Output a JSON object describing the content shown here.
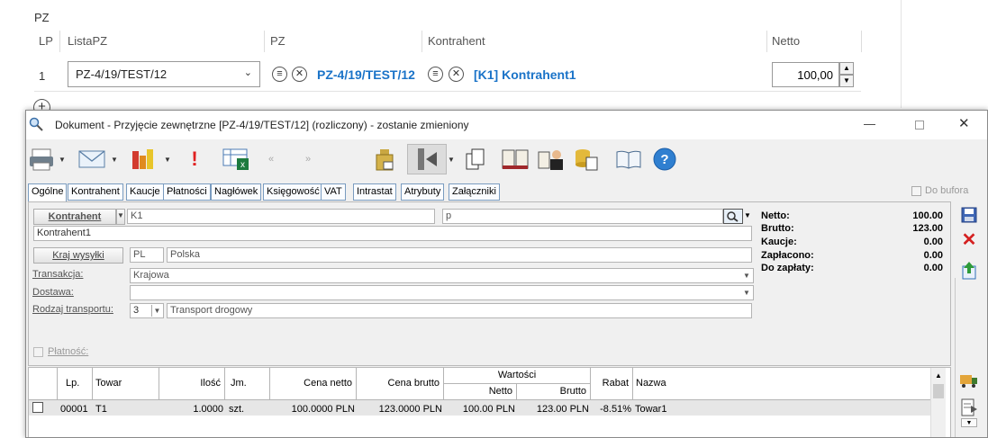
{
  "pz_section": {
    "title": "PZ",
    "headers": {
      "lp": "LP",
      "lista": "ListaPZ",
      "pz": "PZ",
      "kontrahent": "Kontrahent",
      "netto": "Netto"
    },
    "row": {
      "lp": "1",
      "lista_value": "PZ-4/19/TEST/12",
      "pz_link": "PZ-4/19/TEST/12",
      "kontrahent_link": "[K1] Kontrahent1",
      "netto": "100,00"
    }
  },
  "dialog": {
    "title": "Dokument - Przyjęcie zewnętrzne [PZ-4/19/TEST/12] (rozliczony) - zostanie zmieniony",
    "tabs": [
      "Ogólne",
      "Kontrahent",
      "Kaucje",
      "Płatności",
      "Nagłówek",
      "Księgowość",
      "VAT",
      "Intrastat",
      "Atrybuty",
      "Załączniki"
    ],
    "do_bufora": "Do bufora",
    "kontrahent_btn": "Kontrahent",
    "kontrahent_code": "K1",
    "kontrahent_field2": "p",
    "kontrahent_name": "Kontrahent1",
    "kraj_btn": "Kraj wysyłki",
    "kraj_code": "PL",
    "kraj_name": "Polska",
    "transakcja_label": "Transakcja:",
    "transakcja_value": "Krajowa",
    "dostawa_label": "Dostawa:",
    "dostawa_value": "",
    "rodzaj_label": "Rodzaj transportu:",
    "rodzaj_code": "3",
    "rodzaj_value": "Transport drogowy",
    "platnosc_label": "Płatność:",
    "summary": [
      {
        "label": "Netto:",
        "value": "100.00"
      },
      {
        "label": "Brutto:",
        "value": "123.00"
      },
      {
        "label": "Kaucje:",
        "value": "0.00"
      },
      {
        "label": "Zapłacono:",
        "value": "0.00"
      },
      {
        "label": "Do zapłaty:",
        "value": "0.00"
      }
    ],
    "table": {
      "headers": {
        "lp": "Lp.",
        "towar": "Towar",
        "ilosc": "Ilość",
        "jm": "Jm.",
        "cena_netto": "Cena netto",
        "cena_brutto": "Cena brutto",
        "wartosci": "Wartości",
        "w_netto": "Netto",
        "w_brutto": "Brutto",
        "rabat": "Rabat",
        "nazwa": "Nazwa"
      },
      "rows": [
        {
          "lp": "00001",
          "towar": "T1",
          "ilosc": "1.0000",
          "jm": "szt.",
          "cena_netto": "100.0000 PLN",
          "cena_brutto": "123.0000 PLN",
          "w_netto": "100.00 PLN",
          "w_brutto": "123.00 PLN",
          "rabat": "-8.51%",
          "nazwa": "Towar1"
        }
      ]
    }
  },
  "colors": {
    "link": "#1a73c8",
    "tab_border": "#7a9cc0"
  }
}
